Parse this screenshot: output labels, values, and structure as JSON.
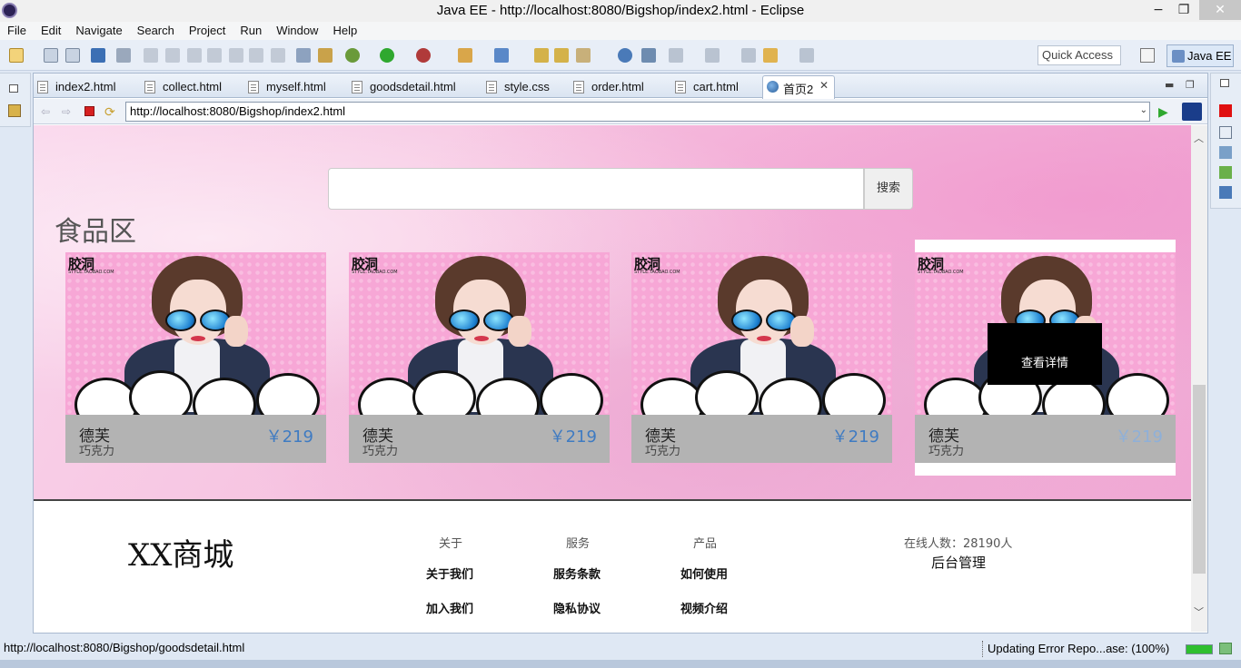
{
  "window": {
    "title": "Java EE - http://localhost:8080/Bigshop/index2.html - Eclipse",
    "minimize": "−",
    "maximize": "❐",
    "close": "✕"
  },
  "menu": [
    "File",
    "Edit",
    "Navigate",
    "Search",
    "Project",
    "Run",
    "Window",
    "Help"
  ],
  "toolbar": {
    "quick_access": "Quick Access",
    "perspective": "Java EE"
  },
  "tabs": [
    {
      "label": "index2.html"
    },
    {
      "label": "collect.html"
    },
    {
      "label": "myself.html"
    },
    {
      "label": "goodsdetail.html"
    },
    {
      "label": "style.css"
    },
    {
      "label": "order.html"
    },
    {
      "label": "cart.html"
    },
    {
      "label": "首页2",
      "active": true
    }
  ],
  "browser": {
    "url": "http://localhost:8080/Bigshop/index2.html"
  },
  "page": {
    "search_button": "搜索",
    "section_title": "食品区",
    "product_logo": "胶洞",
    "product_logo_sub": "STYLE.TAOBAO.COM",
    "products": [
      {
        "name": "德芙",
        "sub": "巧克力",
        "price": "￥219"
      },
      {
        "name": "德芙",
        "sub": "巧克力",
        "price": "￥219"
      },
      {
        "name": "德芙",
        "sub": "巧克力",
        "price": "￥219"
      },
      {
        "name": "德芙",
        "sub": "巧克力",
        "price": "￥219",
        "hover_label": "查看详情"
      }
    ],
    "footer": {
      "brand": "XX商城",
      "columns": [
        {
          "head": "关于",
          "links": [
            "关于我们",
            "加入我们"
          ]
        },
        {
          "head": "服务",
          "links": [
            "服务条款",
            "隐私协议"
          ]
        },
        {
          "head": "产品",
          "links": [
            "如何使用",
            "视频介绍"
          ]
        }
      ],
      "online": "在线人数：28190人",
      "admin": "后台管理"
    }
  },
  "status": {
    "url": "http://localhost:8080/Bigshop/goodsdetail.html",
    "job": "Updating Error Repo...ase: (100%)",
    "progress": 1.0
  },
  "colors": {
    "price": "#3f7bc2",
    "info_band": "#b3b3b3",
    "hero_pink": "#f6c2e0"
  }
}
